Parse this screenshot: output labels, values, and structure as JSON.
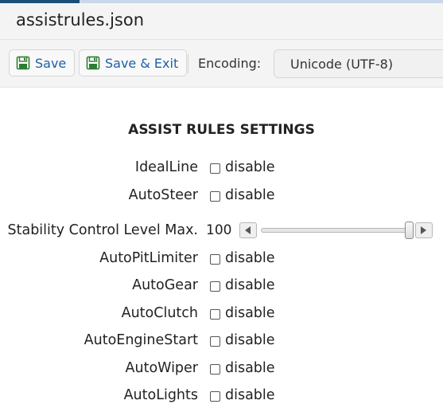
{
  "window": {
    "title": "assistrules.json"
  },
  "toolbar": {
    "save_label": "Save",
    "save_exit_label": "Save & Exit",
    "encoding_label": "Encoding:",
    "encoding_value": "Unicode (UTF-8)"
  },
  "form": {
    "heading": "ASSIST RULES SETTINGS",
    "disable_text": "disable",
    "items": [
      {
        "label": "IdealLine",
        "checked": false
      },
      {
        "label": "AutoSteer",
        "checked": false
      },
      {
        "label": "AutoPitLimiter",
        "checked": false
      },
      {
        "label": "AutoGear",
        "checked": false
      },
      {
        "label": "AutoClutch",
        "checked": false
      },
      {
        "label": "AutoEngineStart",
        "checked": false
      },
      {
        "label": "AutoWiper",
        "checked": false
      },
      {
        "label": "AutoLights",
        "checked": false
      }
    ],
    "slider": {
      "label": "Stability Control Level Max.",
      "value": "100",
      "fraction": 1.0
    }
  },
  "icons": {
    "save": "save-icon",
    "save_exit": "save-exit-icon",
    "slider_left": "arrow-left-icon",
    "slider_right": "arrow-right-icon"
  },
  "colors": {
    "button_text": "#1f5fa8",
    "save_icon": "#2e7d32"
  }
}
